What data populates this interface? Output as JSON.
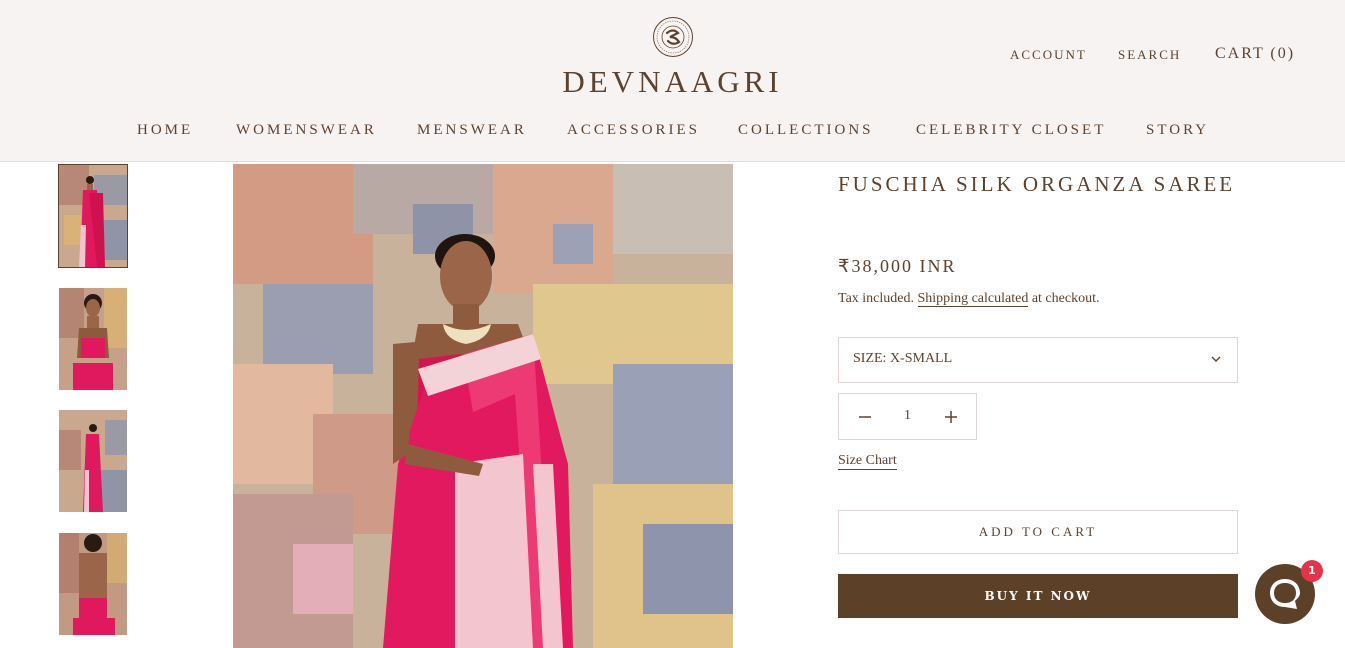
{
  "brand": {
    "name": "DEVNAAGRI",
    "logo_icon": "devnaagri-monogram-icon"
  },
  "utility_nav": {
    "account": "ACCOUNT",
    "search": "SEARCH",
    "cart": "CART (0)"
  },
  "main_nav": [
    "HOME",
    "WOMENSWEAR",
    "MENSWEAR",
    "ACCESSORIES",
    "COLLECTIONS",
    "CELEBRITY CLOSET",
    "STORY"
  ],
  "product": {
    "title": "FUSCHIA SILK ORGANZA SAREE",
    "price": "₹38,000 INR",
    "tax_prefix": "Tax included.",
    "tax_link": "Shipping",
    "tax_mid": "calculated",
    "tax_suffix": "at checkout.",
    "size_label": "SIZE: X-SMALL",
    "quantity": "1",
    "size_chart": "Size Chart",
    "add_to_cart": "ADD TO CART",
    "buy_now": "BUY IT NOW"
  },
  "gallery": {
    "thumbnail_count": 4,
    "selected_index": 0
  },
  "chat": {
    "badge_count": "1",
    "icon": "chat-bubble-icon"
  },
  "colors": {
    "brand_brown": "#5c4027",
    "header_bg": "#f7f3f2",
    "saree_pink": "#e0195f",
    "badge_red": "#e5344a"
  }
}
